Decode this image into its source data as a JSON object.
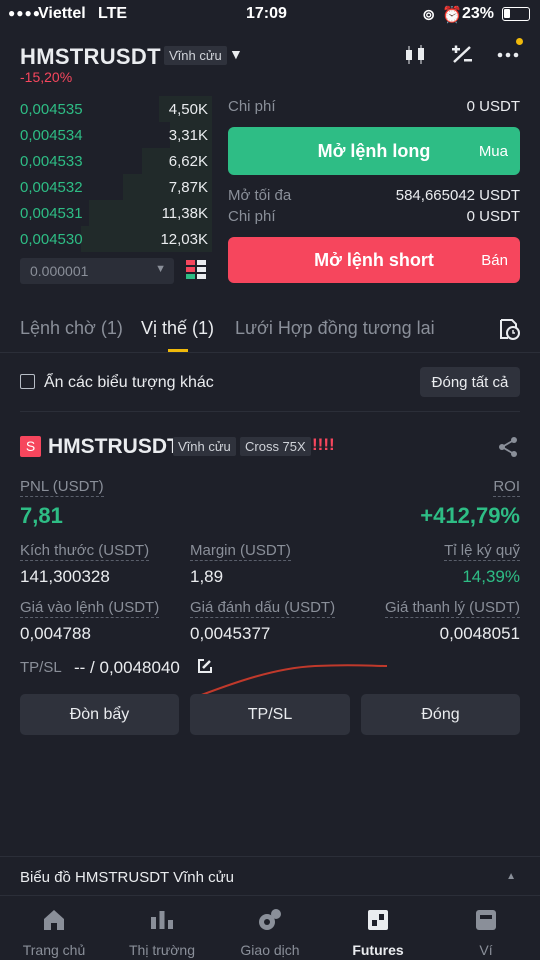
{
  "status_bar": {
    "carrier": "Viettel",
    "network": "LTE",
    "time": "17:09",
    "battery": "23%"
  },
  "header": {
    "symbol": "HMSTRUSDT",
    "contract_type": "Vĩnh cửu",
    "change": "-15,20%"
  },
  "order_book": {
    "rows": [
      {
        "price": "0,004535",
        "qty": "4,50K",
        "depth": 0.25
      },
      {
        "price": "0,004534",
        "qty": "3,31K",
        "depth": 0.2
      },
      {
        "price": "0,004533",
        "qty": "6,62K",
        "depth": 0.33
      },
      {
        "price": "0,004532",
        "qty": "7,87K",
        "depth": 0.42
      },
      {
        "price": "0,004531",
        "qty": "11,38K",
        "depth": 0.58
      },
      {
        "price": "0,004530",
        "qty": "12,03K",
        "depth": 0.62
      }
    ],
    "precision": "0.000001"
  },
  "order_panel": {
    "cost_label": "Chi phí",
    "cost_long": "0 USDT",
    "long_button": "Mở lệnh long",
    "long_side": "Mua",
    "max_open_label": "Mở tối đa",
    "max_open": "584,665042 USDT",
    "cost_short": "0 USDT",
    "short_button": "Mở lệnh short",
    "short_side": "Bán"
  },
  "tabs": {
    "pending": "Lệnh chờ (1)",
    "positions": "Vị thế (1)",
    "grid": "Lưới Hợp đồng tương lai"
  },
  "filter": {
    "hide_label": "Ẩn các biểu tượng khác",
    "close_all": "Đóng tất cả"
  },
  "position": {
    "side_badge": "S",
    "symbol": "HMSTRUSDT",
    "contract_type": "Vĩnh cửu",
    "margin_mode": "Cross 75X",
    "risk": "!!!!",
    "pnl_label": "PNL (USDT)",
    "pnl": "7,81",
    "roi_label": "ROI",
    "roi": "+412,79%",
    "size_label": "Kích thước (USDT)",
    "size": "141,300328",
    "margin_label": "Margin (USDT)",
    "margin": "1,89",
    "margin_ratio_label": "Tỉ lệ ký quỹ",
    "margin_ratio": "14,39%",
    "entry_label": "Giá vào lệnh (USDT)",
    "entry": "0,004788",
    "mark_label": "Giá đánh dấu (USDT)",
    "mark": "0,0045377",
    "liq_label": "Giá thanh lý (USDT)",
    "liq": "0,0048051",
    "tpsl_label": "TP/SL",
    "tpsl_value": "-- / 0,0048040",
    "btn_leverage": "Đòn bẩy",
    "btn_tpsl": "TP/SL",
    "btn_close": "Đóng"
  },
  "chart_bar": {
    "label": "Biểu đồ HMSTRUSDT Vĩnh cửu"
  },
  "nav": [
    {
      "label": "Trang chủ",
      "icon": "home-icon"
    },
    {
      "label": "Thị trường",
      "icon": "market-icon"
    },
    {
      "label": "Giao dịch",
      "icon": "trade-icon"
    },
    {
      "label": "Futures",
      "icon": "futures-icon"
    },
    {
      "label": "Ví",
      "icon": "wallet-icon"
    }
  ],
  "colors": {
    "background": "#1e2029",
    "green": "#2ebd85",
    "red": "#f6465d",
    "accent": "#f0b90b",
    "muted": "#8a8f99"
  }
}
